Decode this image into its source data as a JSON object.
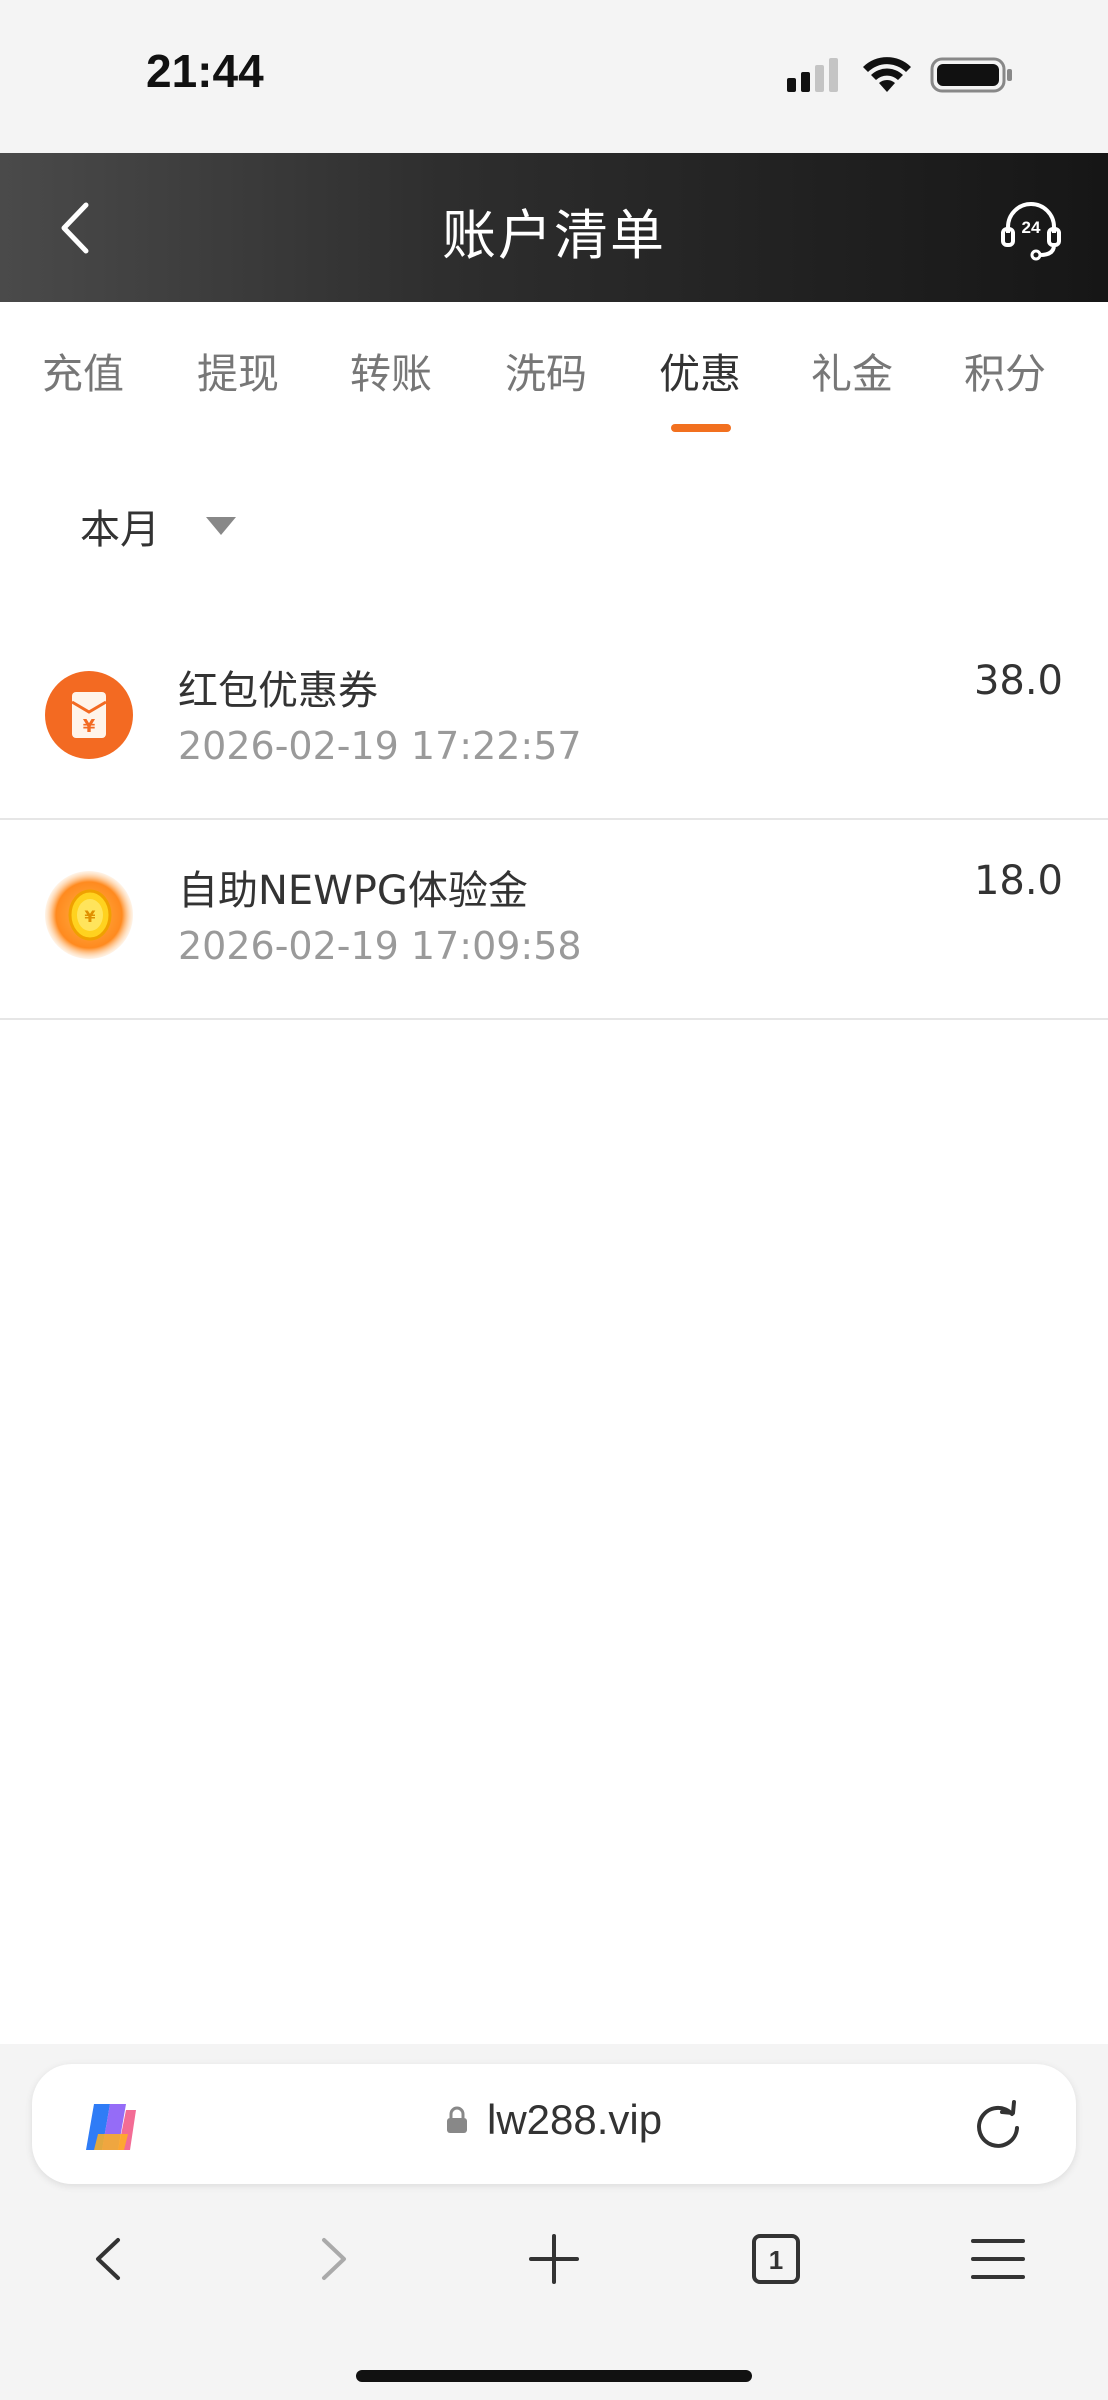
{
  "status_bar": {
    "time": "21:44",
    "icons": [
      "cellular-signal-icon",
      "wifi-icon",
      "battery-icon"
    ]
  },
  "header": {
    "title": "账户清单",
    "back_icon": "chevron-left-icon",
    "support_icon": "support-24h-headset-icon",
    "support_badge": "24"
  },
  "tabs": [
    {
      "label": "充值",
      "active": false
    },
    {
      "label": "提现",
      "active": false
    },
    {
      "label": "转账",
      "active": false
    },
    {
      "label": "洗码",
      "active": false
    },
    {
      "label": "优惠",
      "active": true
    },
    {
      "label": "礼金",
      "active": false
    },
    {
      "label": "积分",
      "active": false
    }
  ],
  "filter": {
    "selected": "本月",
    "icon": "caret-down-icon"
  },
  "records": [
    {
      "title": "红包优惠券",
      "time": "2026-02-19 17:22:57",
      "amount": "38.0",
      "icon": "red-envelope-icon"
    },
    {
      "title": "自助NEWPG体验金",
      "time": "2026-02-19 17:09:58",
      "amount": "18.0",
      "icon": "gold-coin-icon"
    }
  ],
  "browser": {
    "url": "lw288.vip",
    "tab_count": "1",
    "icons": [
      "copilot-icon",
      "lock-icon",
      "reload-icon",
      "back-arrow-icon",
      "forward-arrow-icon",
      "new-tab-plus-icon",
      "tabs-icon",
      "menu-icon"
    ]
  },
  "colors": {
    "accent": "#f2701f",
    "header_start": "#4a4a4a",
    "header_end": "#161616",
    "muted_text": "#9a9a9a"
  }
}
